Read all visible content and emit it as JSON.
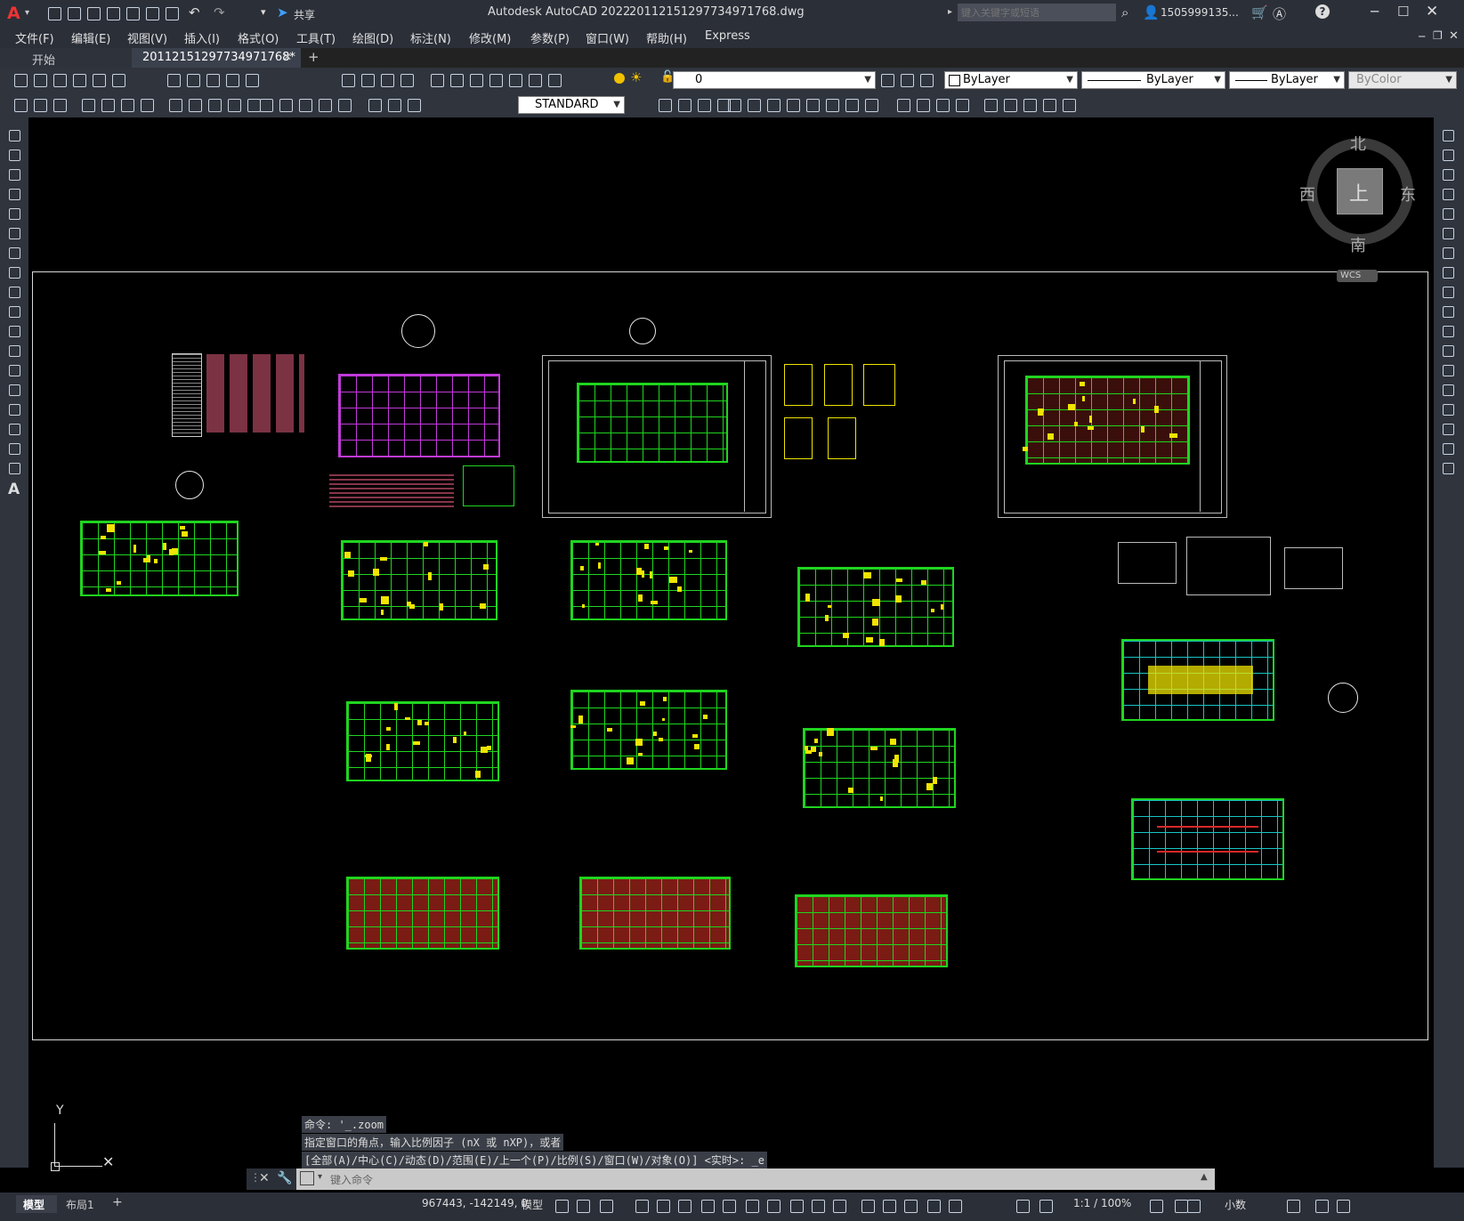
{
  "app": {
    "title": "Autodesk AutoCAD 2022",
    "filename": "20112151297734971768.dwg",
    "share_label": "共享",
    "search_placeholder": "键入关键字或短语",
    "user": "1505999135...",
    "help": "?"
  },
  "menu": [
    "文件(F)",
    "编辑(E)",
    "视图(V)",
    "插入(I)",
    "格式(O)",
    "工具(T)",
    "绘图(D)",
    "标注(N)",
    "修改(M)",
    "参数(P)",
    "窗口(W)",
    "帮助(H)",
    "Express"
  ],
  "tabs": {
    "start": "开始",
    "active": "20112151297734971768*",
    "add": "+"
  },
  "toolbar1": {
    "layer_value": "0",
    "color_value": "ByLayer",
    "linetype_value": "ByLayer",
    "lineweight_value": "ByLayer",
    "plotstyle_value": "ByColor"
  },
  "toolbar2": {
    "textstyle_value": "STANDARD"
  },
  "viewcube": {
    "north": "北",
    "south": "南",
    "east": "东",
    "west": "西",
    "top": "上",
    "wcs": "WCS"
  },
  "ucs": {
    "y": "Y"
  },
  "command": {
    "history": [
      "命令: '_.zoom",
      "指定窗口的角点，输入比例因子 (nX 或 nXP)，或者",
      "[全部(A)/中心(C)/动态(D)/范围(E)/上一个(P)/比例(S)/窗口(W)/对象(O)] <实时>: _e"
    ],
    "placeholder": "键入命令"
  },
  "layout_tabs": [
    "模型",
    "布局1",
    "+"
  ],
  "status": {
    "coords": "967443, -142149, 0",
    "model": "模型",
    "scale": "1:1 / 100%",
    "units": "小数"
  },
  "colors": {
    "grid_green": "#1fd51f",
    "annotation_yellow": "#f0e400",
    "hatch_red": "#7a1c14",
    "text_red": "#e05a7a",
    "ui_dark": "#2b2f38"
  }
}
